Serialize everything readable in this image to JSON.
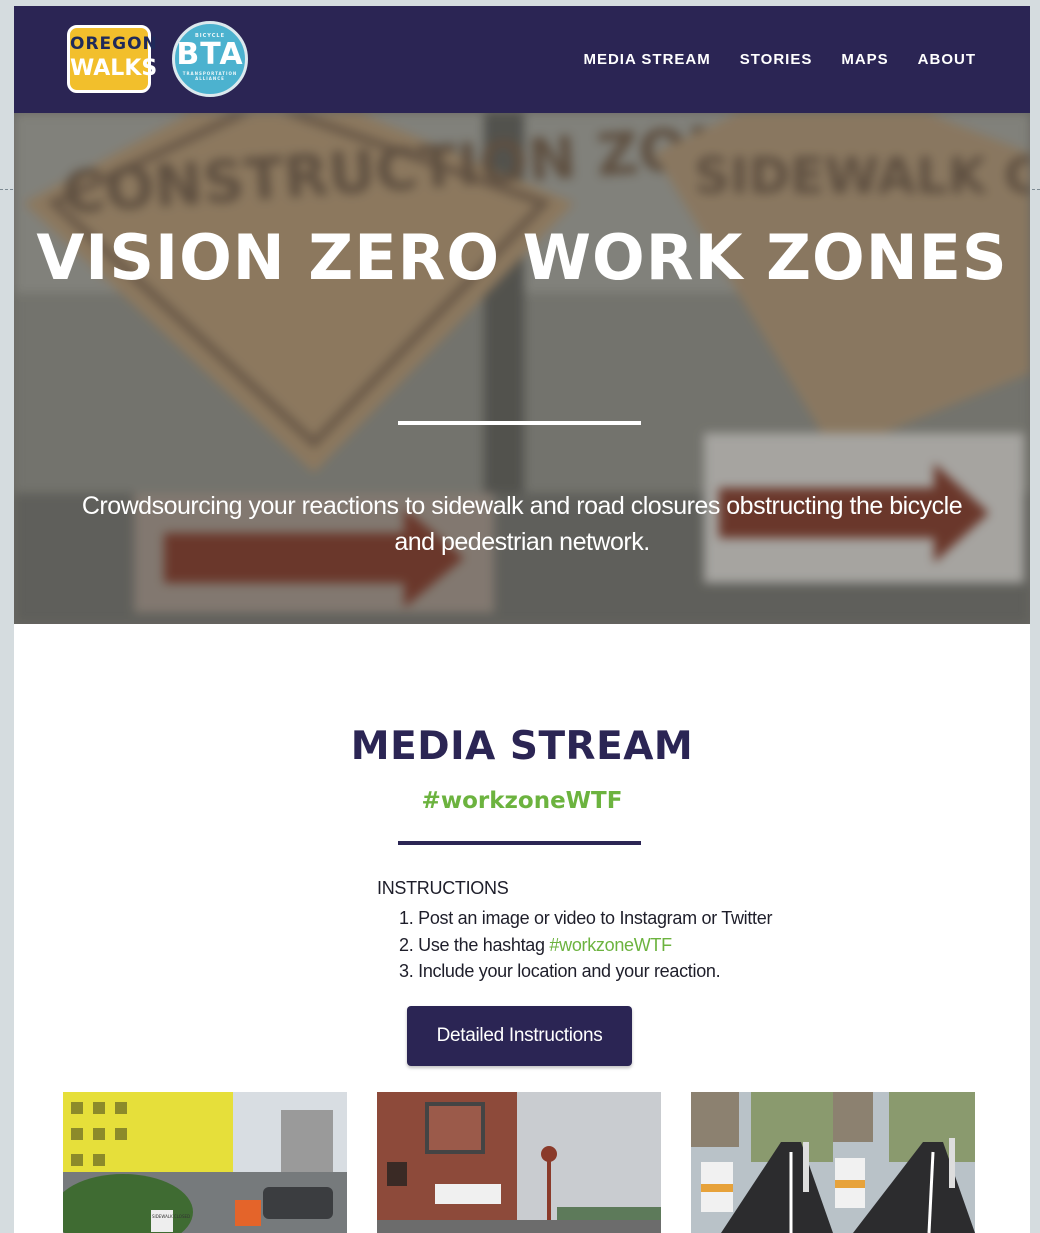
{
  "nav": {
    "logo_oregon_line1": "OREGON",
    "logo_oregon_line2": "WALKS",
    "logo_bta_top": "BICYCLE",
    "logo_bta_main": "BTA",
    "logo_bta_bottom": "TRANSPORTATION ALLIANCE",
    "menu": [
      "MEDIA STREAM",
      "STORIES",
      "MAPS",
      "ABOUT"
    ]
  },
  "hero": {
    "title": "VISION ZERO WORK ZONES",
    "subtitle": "Crowdsourcing your reactions to sidewalk and road closures obstructing the bicycle and pedestrian network.",
    "background_signs": [
      "CONSTRUCTION ZONE",
      "SIDEWALK CLOSED"
    ]
  },
  "media_stream": {
    "title": "MEDIA STREAM",
    "hashtag": "#workzoneWTF",
    "instructions_heading": "INSTRUCTIONS",
    "steps": [
      {
        "num": "1.",
        "text": "Post an image or video to Instagram or Twitter",
        "tag": ""
      },
      {
        "num": "2.",
        "text": "Use the hashtag ",
        "tag": "#workzoneWTF"
      },
      {
        "num": "3.",
        "text": "Include your location and your reaction.",
        "tag": ""
      }
    ],
    "button_label": "Detailed Instructions",
    "thumb_signs": [
      "SIDEWALK CLOSED"
    ]
  },
  "colors": {
    "brand_navy": "#2b2554",
    "accent_green": "#6cb33f",
    "oregon_yellow": "#f2bf2c",
    "bta_blue": "#4cb2cf"
  }
}
